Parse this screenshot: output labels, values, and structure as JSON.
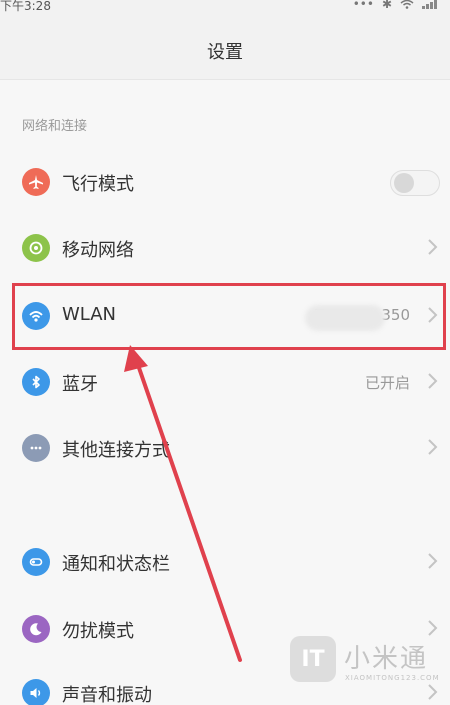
{
  "status_bar": {
    "time": "下午3:28",
    "icons": [
      "more-dots-icon",
      "bluetooth-icon",
      "wifi-icon",
      "signal-icon"
    ]
  },
  "header": {
    "title": "设置"
  },
  "section": {
    "label": "网络和连接"
  },
  "rows": [
    {
      "id": "airplane",
      "label": "飞行模式",
      "icon": "airplane-icon",
      "color": "#ef6b57",
      "control": "toggle",
      "toggle_on": false
    },
    {
      "id": "mobile-network",
      "label": "移动网络",
      "icon": "mobile-network-icon",
      "color": "#8dc34a",
      "control": "chevron"
    },
    {
      "id": "wlan",
      "label": "WLAN",
      "value": "T            350",
      "icon": "wifi-icon",
      "color": "#3d98e8",
      "control": "chevron"
    },
    {
      "id": "bluetooth",
      "label": "蓝牙",
      "value": "已开启",
      "icon": "bluetooth-icon",
      "color": "#3d98e8",
      "control": "chevron"
    },
    {
      "id": "other-connections",
      "label": "其他连接方式",
      "icon": "more-dots-icon",
      "color": "#8c9bb5",
      "control": "chevron"
    },
    {
      "id": "notifications",
      "label": "通知和状态栏",
      "icon": "notification-toggle-icon",
      "color": "#3d98e8",
      "control": "chevron"
    },
    {
      "id": "do-not-disturb",
      "label": "勿扰模式",
      "icon": "moon-icon",
      "color": "#9b66c2",
      "control": "chevron"
    },
    {
      "id": "sound",
      "label": "声音和振动",
      "icon": "speaker-icon",
      "color": "#3d98e8",
      "control": "chevron"
    }
  ],
  "watermark": {
    "badge": "IT",
    "text": "小米通",
    "sub": "XIAOMITONG123.COM"
  },
  "colors": {
    "highlight": "#e0414d",
    "arrow": "#e0414d"
  }
}
